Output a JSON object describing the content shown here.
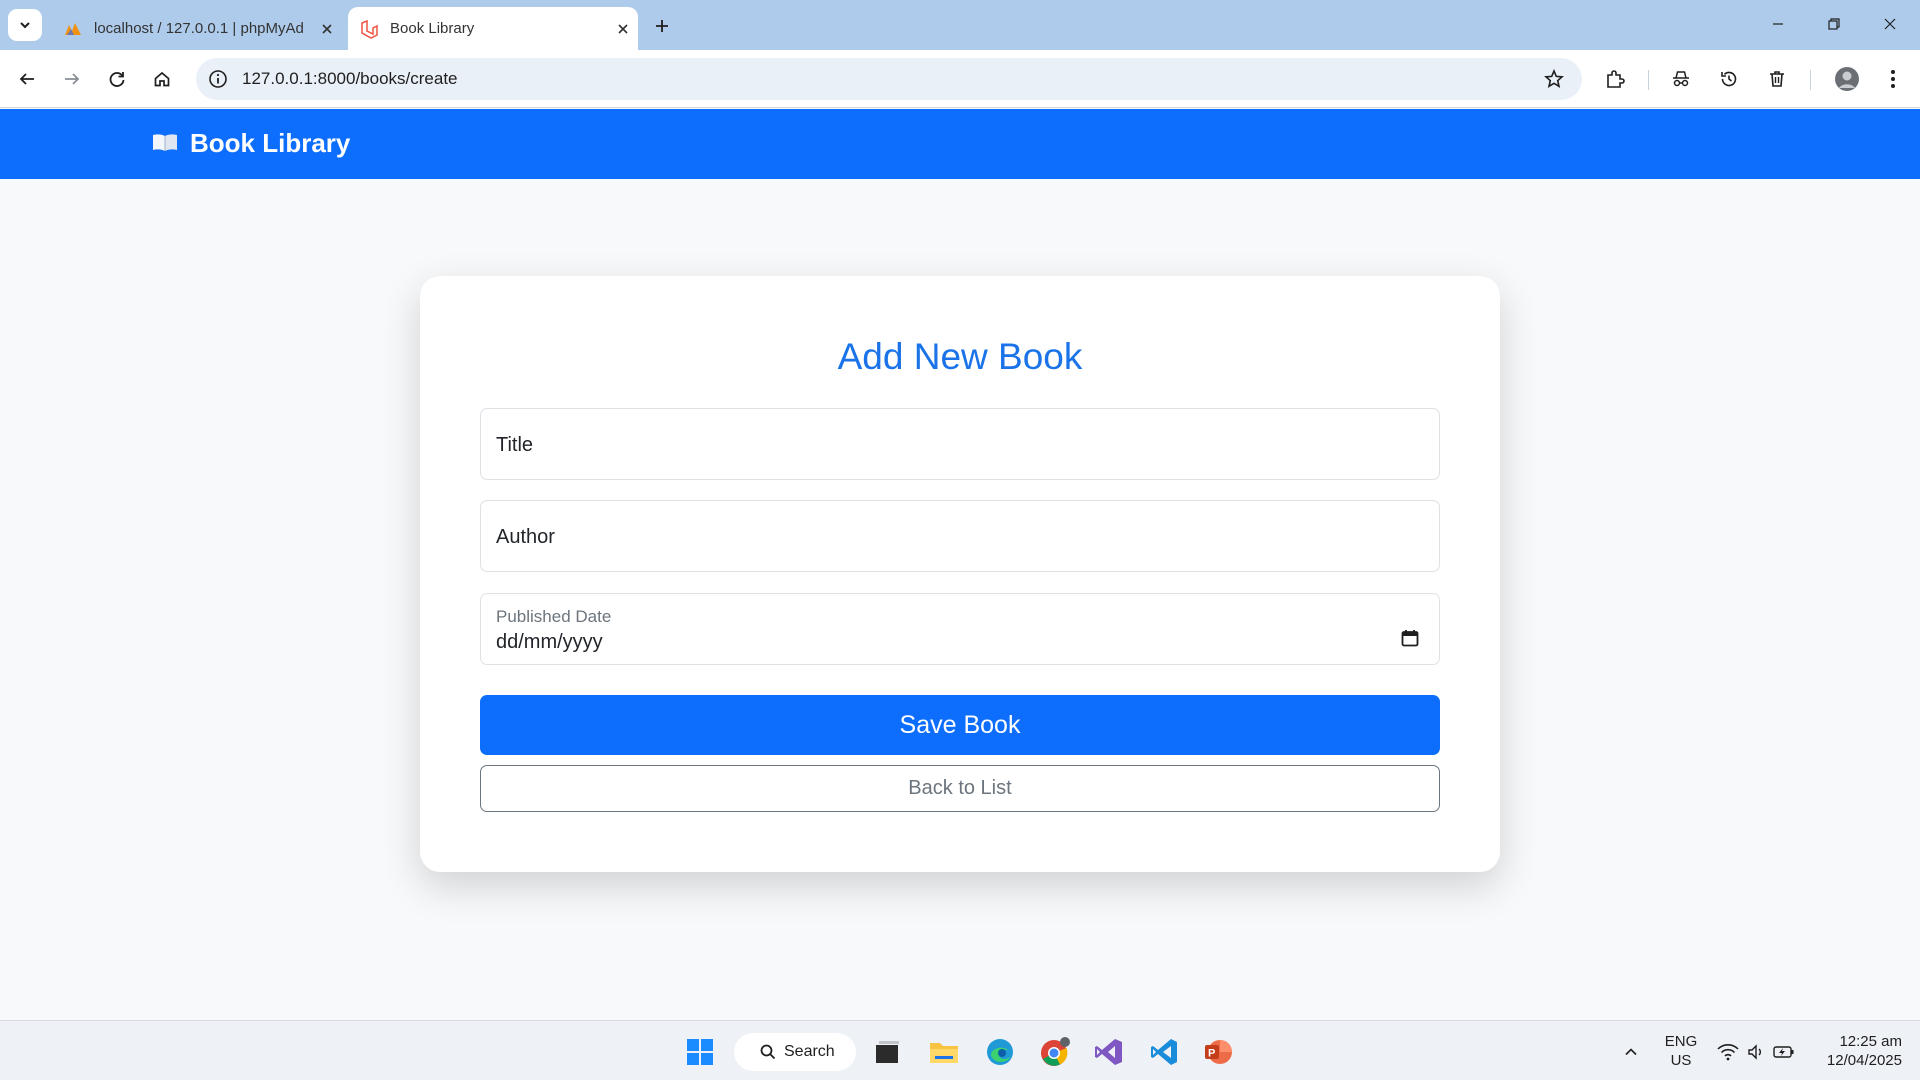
{
  "browser": {
    "tabs": [
      {
        "title": "localhost / 127.0.0.1 | phpMyAd",
        "active": false
      },
      {
        "title": "Book Library",
        "active": true
      }
    ],
    "url": "127.0.0.1:8000/books/create"
  },
  "navbar": {
    "brand_icon": "📖",
    "brand": "Book Library"
  },
  "form": {
    "heading": "Add New Book",
    "title_placeholder": "Title",
    "author_placeholder": "Author",
    "date_label": "Published Date",
    "date_value": "dd/mm/yyyy",
    "save_label": "Save Book",
    "back_label": "Back to List"
  },
  "taskbar": {
    "search_label": "Search",
    "language": "ENG",
    "region": "US",
    "time": "12:25 am",
    "date": "12/04/2025"
  },
  "colors": {
    "primary": "#0d6efd",
    "heading": "#1a73e8",
    "tabstrip": "#aecbeb"
  }
}
